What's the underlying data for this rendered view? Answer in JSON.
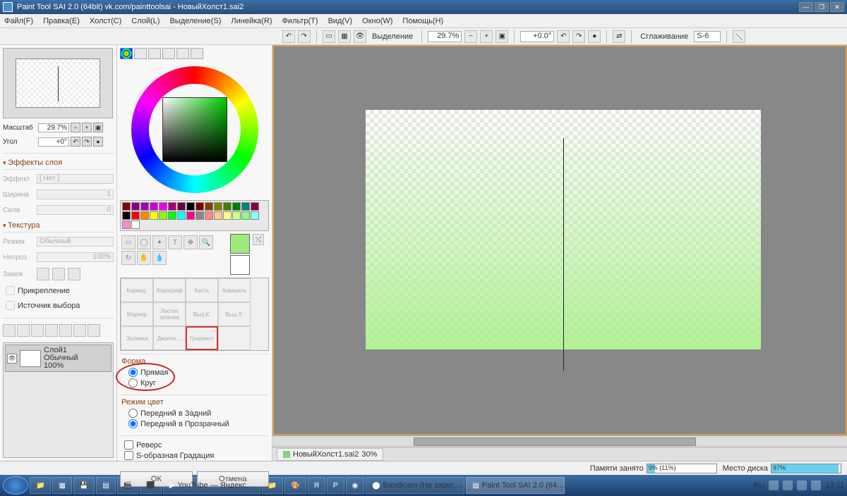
{
  "titlebar": {
    "text": "Paint Tool SAI 2.0 (64bit) vk.com/painttoolsai - НовыйХолст1.sai2"
  },
  "menu": [
    "Файл(F)",
    "Правка(E)",
    "Холст(C)",
    "Слой(L)",
    "Выделение(S)",
    "Линейка(R)",
    "Фильтр(T)",
    "Вид(V)",
    "Окно(W)",
    "Помощь(H)"
  ],
  "toolbar": {
    "selection": "Выделение",
    "zoom": "29.7%",
    "angle": "+0.0°",
    "smooth_label": "Сглаживание",
    "smooth": "S-6"
  },
  "nav": {
    "scale_label": "Масштаб",
    "scale": "29.7%",
    "angle_label": "Угол",
    "angle": "+0°"
  },
  "panels": {
    "fx": "Эффекты слоя",
    "fx_effect": "Эффект",
    "fx_effect_val": "[ Нет ]",
    "fx_width": "Ширина",
    "fx_width_val": "1",
    "fx_power": "Сила",
    "fx_power_val": "0",
    "texture": "Текстура",
    "tex_mode": "Режим",
    "tex_mode_val": "Обычный",
    "tex_opacity": "Непроз.",
    "tex_opacity_val": "100%",
    "tex_lock": "Замок",
    "tex_attach": "Прикрепление",
    "tex_src": "Источник выбора"
  },
  "layer": {
    "name": "Слой1",
    "mode": "Обычный",
    "opacity": "100%"
  },
  "brushes": [
    "Каранд.",
    "Аэрограф",
    "Кисть",
    "Акварель",
    "Маркер",
    "Ластик цпонжа",
    "Выд.К.",
    "Выд.Л.",
    "Заливка",
    "Двоичн…",
    "Градиент",
    ""
  ],
  "gradient": {
    "form": "Форма",
    "line": "Прямая",
    "circle": "Круг",
    "colormode": "Режим цвет",
    "front_back": "Передний в Задний",
    "front_trans": "Передний в Прозрачный",
    "reverse": "Реверс",
    "scurve": "S-образная Градация",
    "ok": "ОК",
    "cancel": "Отмена"
  },
  "doctab": {
    "name": "НовыйХолст1.sai2",
    "zoom": "30%"
  },
  "status": {
    "mem_label": "Памяти занято",
    "mem": "9% (11%)",
    "disk_label": "Место диска",
    "disk": "97%"
  },
  "taskbar": {
    "items": [
      "YouTube — Яндекс…",
      "",
      "",
      "",
      "",
      "",
      "Bandicam (Не зарег…",
      "Paint Tool SAI 2.0 (64…"
    ],
    "lang": "RU",
    "time": "13:11"
  },
  "swatch_colors": [
    "#800",
    "#808",
    "#a0a",
    "#c0c",
    "#e0e",
    "#a06",
    "#604",
    "#000",
    "#800000",
    "#804000",
    "#808000",
    "#408000",
    "#008000",
    "#008080",
    "#804",
    "#000",
    "#f00",
    "#f80",
    "#ff0",
    "#8f0",
    "#0f0",
    "#0ff",
    "#f08",
    "#888",
    "#f88",
    "#fc8",
    "#ff8",
    "#cf8",
    "#8f8",
    "#8ff",
    "#f8c",
    "#fff"
  ]
}
